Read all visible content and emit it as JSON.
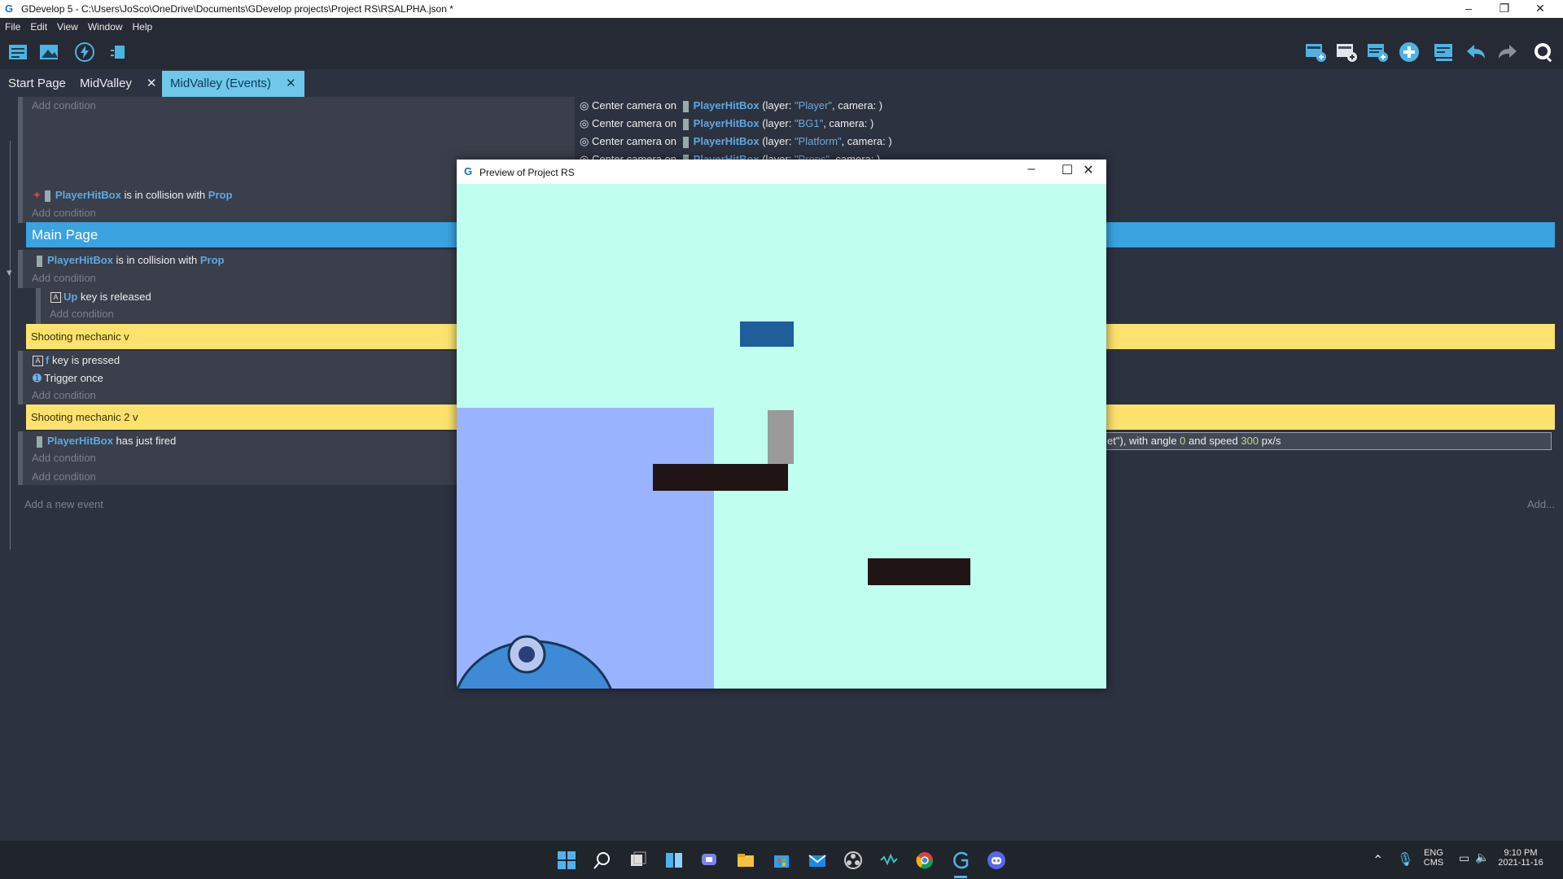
{
  "window": {
    "title": "GDevelop 5 - C:\\Users\\JoSco\\OneDrive\\Documents\\GDevelop projects\\Project RS\\RSALPHA.json *",
    "minimize": "–",
    "maximize": "❐",
    "close": "✕"
  },
  "menu": [
    "File",
    "Edit",
    "View",
    "Window",
    "Help"
  ],
  "tabs": [
    {
      "label": "Start Page",
      "closable": false
    },
    {
      "label": "MidValley",
      "closable": true
    },
    {
      "label": "MidValley (Events)",
      "closable": true
    }
  ],
  "tab_close": "✕",
  "events": {
    "add_condition": "Add condition",
    "add_new_event": "Add a new event",
    "add_right": "Add...",
    "center_camera": "Center camera on",
    "camera_actions": [
      {
        "object": "PlayerHitBox",
        "pre": "(layer: ",
        "layer": "\"Player\"",
        "post": ", camera: )"
      },
      {
        "object": "PlayerHitBox",
        "pre": "(layer: ",
        "layer": "\"BG1\"",
        "post": ", camera: )"
      },
      {
        "object": "PlayerHitBox",
        "pre": "(layer: ",
        "layer": "\"Platform\"",
        "post": ", camera: )"
      },
      {
        "object": "PlayerHitBox",
        "pre": "(layer: ",
        "layer": "\"Props\"",
        "post": ", camera: )"
      }
    ],
    "collision1": {
      "object": "PlayerHitBox",
      "text": "is in collision with",
      "target": "Prop"
    },
    "main_page": "Main Page",
    "collision2": {
      "object": "PlayerHitBox",
      "text": "is in collision with",
      "target": "Prop"
    },
    "up_key": {
      "key": "Up",
      "text": "key is released"
    },
    "shooting1": "Shooting mechanic v",
    "f_key": {
      "key": "f",
      "text": "key is pressed"
    },
    "trigger_once": "Trigger once",
    "shooting2": "Shooting mechanic 2 v",
    "fired": {
      "object": "PlayerHitBox",
      "text": "has just fired"
    },
    "fire_action": {
      "pre": "et\"), with angle ",
      "angle": "0",
      "mid": " and speed ",
      "speed": "300",
      "post": " px/s"
    }
  },
  "preview": {
    "title": "Preview of Project RS",
    "minimize": "–",
    "maximize": "☐",
    "close": "✕"
  },
  "taskbar": {
    "lang_top": "ENG",
    "lang_bottom": "CMS",
    "time": "9:10 PM",
    "date": "2021-11-16"
  },
  "colors": {
    "accent": "#3aa3e0",
    "comment": "#fde26d",
    "canvas_bg": "#c0fff0",
    "object_text": "#5fa8e0"
  }
}
